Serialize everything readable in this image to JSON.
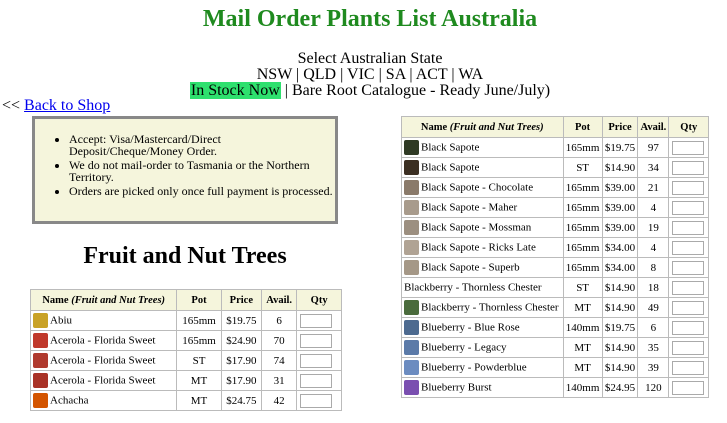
{
  "page_title": "Mail Order Plants List Australia",
  "state_prompt": "Select Australian State",
  "states": [
    "NSW",
    "QLD",
    "VIC",
    "SA",
    "ACT",
    "WA"
  ],
  "catalogue": {
    "in_stock": "In Stock Now",
    "bare_root": "Bare Root Catalogue - Ready June/July)"
  },
  "back_link": "Back to Shop",
  "notice_items": [
    "Accept: Visa/Mastercard/Direct Deposit/Cheque/Money Order.",
    "We do not mail-order to Tasmania or the Northern Territory.",
    "Orders are picked only once full payment is processed."
  ],
  "section_title": "Fruit and Nut Trees",
  "table_headers": {
    "name": "Name",
    "name_qualifier": "(Fruit and Nut Trees)",
    "pot": "Pot",
    "price": "Price",
    "avail": "Avail.",
    "qty": "Qty"
  },
  "left_rows": [
    {
      "name": "Abiu",
      "pot": "165mm",
      "price": "$19.75",
      "avail": "6",
      "thumb": "#c9a227"
    },
    {
      "name": "Acerola - Florida Sweet",
      "pot": "165mm",
      "price": "$24.90",
      "avail": "70",
      "thumb": "#c0392b"
    },
    {
      "name": "Acerola - Florida Sweet",
      "pot": "ST",
      "price": "$17.90",
      "avail": "74",
      "thumb": "#b03a2e"
    },
    {
      "name": "Acerola - Florida Sweet",
      "pot": "MT",
      "price": "$17.90",
      "avail": "31",
      "thumb": "#a93226"
    },
    {
      "name": "Achacha",
      "pot": "MT",
      "price": "$24.75",
      "avail": "42",
      "thumb": "#d35400"
    }
  ],
  "right_rows": [
    {
      "name": "Black Sapote",
      "pot": "165mm",
      "price": "$19.75",
      "avail": "97",
      "thumb": "#2f3a24"
    },
    {
      "name": "Black Sapote",
      "pot": "ST",
      "price": "$14.90",
      "avail": "34",
      "thumb": "#3b2f22"
    },
    {
      "name": "Black Sapote - Chocolate",
      "pot": "165mm",
      "price": "$39.00",
      "avail": "21",
      "thumb": "#8a7a6a"
    },
    {
      "name": "Black Sapote - Maher",
      "pot": "165mm",
      "price": "$39.00",
      "avail": "4",
      "thumb": "#a89b8c"
    },
    {
      "name": "Black Sapote - Mossman",
      "pot": "165mm",
      "price": "$39.00",
      "avail": "19",
      "thumb": "#9c8f80"
    },
    {
      "name": "Black Sapote - Ricks Late",
      "pot": "165mm",
      "price": "$34.00",
      "avail": "4",
      "thumb": "#b0a394"
    },
    {
      "name": "Black Sapote - Superb",
      "pot": "165mm",
      "price": "$34.00",
      "avail": "8",
      "thumb": "#a59887"
    },
    {
      "name": "Blackberry - Thornless Chester",
      "pot": "ST",
      "price": "$14.90",
      "avail": "18",
      "thumb": ""
    },
    {
      "name": "Blackberry - Thornless Chester",
      "pot": "MT",
      "price": "$14.90",
      "avail": "49",
      "thumb": "#4a6b3c"
    },
    {
      "name": "Blueberry - Blue Rose",
      "pot": "140mm",
      "price": "$19.75",
      "avail": "6",
      "thumb": "#4d6a8f"
    },
    {
      "name": "Blueberry - Legacy",
      "pot": "MT",
      "price": "$14.90",
      "avail": "35",
      "thumb": "#5b7aa8"
    },
    {
      "name": "Blueberry - Powderblue",
      "pot": "MT",
      "price": "$14.90",
      "avail": "39",
      "thumb": "#6c8cc0"
    },
    {
      "name": "Blueberry Burst",
      "pot": "140mm",
      "price": "$24.95",
      "avail": "120",
      "thumb": "#7a4fb0"
    }
  ]
}
